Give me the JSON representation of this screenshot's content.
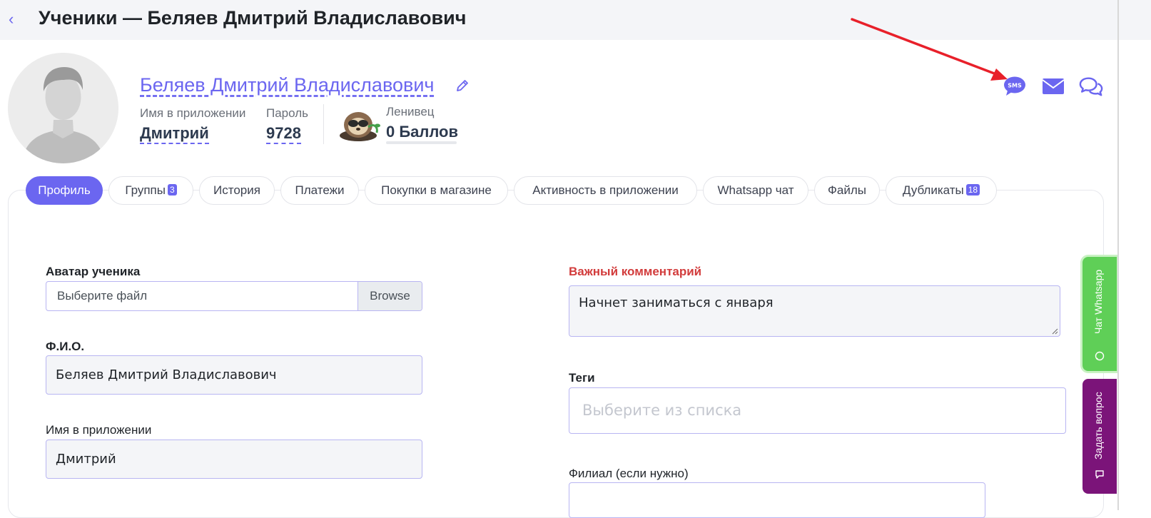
{
  "header": {
    "back_icon": "chevron-left-icon",
    "title": "Ученики — Беляев Дмитрий Владиславович"
  },
  "profile": {
    "name": "Беляев Дмитрий Владиславович",
    "app_name_label": "Имя в приложении",
    "app_name_value": "Дмитрий",
    "password_label": "Пароль",
    "password_value": "9728",
    "level_label": "Ленивец",
    "points_value": "0 Баллов",
    "actions": [
      "sms-icon",
      "envelope-icon",
      "chat-bubbles-icon"
    ]
  },
  "tabs": [
    {
      "label": "Профиль",
      "badge": ""
    },
    {
      "label": "Группы",
      "badge": "3"
    },
    {
      "label": "История",
      "badge": ""
    },
    {
      "label": "Платежи",
      "badge": ""
    },
    {
      "label": "Покупки в магазине",
      "badge": ""
    },
    {
      "label": "Активность в приложении",
      "badge": ""
    },
    {
      "label": "Whatsapp чат",
      "badge": ""
    },
    {
      "label": "Файлы",
      "badge": ""
    },
    {
      "label": "Дубликаты",
      "badge": "18"
    }
  ],
  "form": {
    "avatar_label": "Аватар ученика",
    "file_placeholder": "Выберите файл",
    "browse_label": "Browse",
    "fio_label": "Ф.И.О.",
    "fio_value": "Беляев Дмитрий Владиславович",
    "app_name_label": "Имя в приложении",
    "app_name_value": "Дмитрий",
    "important_label": "Важный комментарий",
    "important_value": "Начнет заниматься с января",
    "tags_label": "Теги",
    "tags_placeholder": "Выберите из списка",
    "branch_label": "Филиал (если нужно)"
  },
  "side": {
    "whatsapp_label": "Чат Whatsapp",
    "question_label": "Задать вопрос"
  },
  "colors": {
    "accent": "#6b66f0",
    "important": "#d23c3c",
    "whatsapp": "#5fcf57",
    "question": "#7b1479",
    "arrow": "#e8202a"
  }
}
